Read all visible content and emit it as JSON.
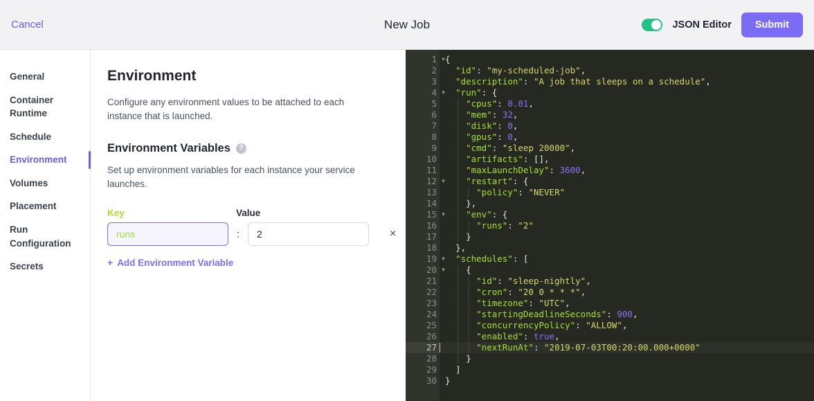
{
  "header": {
    "cancel_label": "Cancel",
    "title": "New Job",
    "toggle_label": "JSON Editor",
    "toggle_state": "on",
    "submit_label": "Submit",
    "accent_color": "#7c6cf5",
    "toggle_on_color": "#22c185",
    "background": "#f2f2f4"
  },
  "sidebar": {
    "items": [
      {
        "label": "General",
        "active": false
      },
      {
        "label": "Container Runtime",
        "active": false
      },
      {
        "label": "Schedule",
        "active": false
      },
      {
        "label": "Environment",
        "active": true
      },
      {
        "label": "Volumes",
        "active": false
      },
      {
        "label": "Placement",
        "active": false
      },
      {
        "label": "Run Configuration",
        "active": false
      },
      {
        "label": "Secrets",
        "active": false
      }
    ],
    "active_color": "#6c5ce7"
  },
  "main": {
    "title": "Environment",
    "description": "Configure any environment values to be attached to each instance that is launched.",
    "subsection": {
      "title": "Environment Variables",
      "help_icon": "question-circle-icon",
      "description": "Set up environment variables for each instance your service launches."
    },
    "labels": {
      "key": "Key",
      "value": "Value"
    },
    "separator": ":",
    "rows": [
      {
        "key": "runs",
        "value": "2",
        "key_placeholder": "",
        "value_placeholder": "",
        "key_focused": true,
        "remove_label": "×"
      }
    ],
    "add_label": "Add Environment Variable",
    "add_icon": "plus-icon"
  },
  "editor": {
    "active_line": 27,
    "total_lines": 30,
    "background": "#262822",
    "gutter_background": "#31342c",
    "lines": [
      {
        "n": 1,
        "fold": true,
        "indent": 0,
        "tokens": [
          {
            "t": "punct",
            "v": "{"
          }
        ]
      },
      {
        "n": 2,
        "fold": false,
        "indent": 1,
        "tokens": [
          {
            "t": "key",
            "v": "\"id\""
          },
          {
            "t": "punct",
            "v": ": "
          },
          {
            "t": "str",
            "v": "\"my-scheduled-job\""
          },
          {
            "t": "punct",
            "v": ","
          }
        ]
      },
      {
        "n": 3,
        "fold": false,
        "indent": 1,
        "tokens": [
          {
            "t": "key",
            "v": "\"description\""
          },
          {
            "t": "punct",
            "v": ": "
          },
          {
            "t": "str",
            "v": "\"A job that sleeps on a schedule\""
          },
          {
            "t": "punct",
            "v": ","
          }
        ]
      },
      {
        "n": 4,
        "fold": true,
        "indent": 1,
        "tokens": [
          {
            "t": "key",
            "v": "\"run\""
          },
          {
            "t": "punct",
            "v": ": {"
          }
        ]
      },
      {
        "n": 5,
        "fold": false,
        "indent": 2,
        "tokens": [
          {
            "t": "key",
            "v": "\"cpus\""
          },
          {
            "t": "punct",
            "v": ": "
          },
          {
            "t": "num",
            "v": "0.01"
          },
          {
            "t": "punct",
            "v": ","
          }
        ]
      },
      {
        "n": 6,
        "fold": false,
        "indent": 2,
        "tokens": [
          {
            "t": "key",
            "v": "\"mem\""
          },
          {
            "t": "punct",
            "v": ": "
          },
          {
            "t": "num",
            "v": "32"
          },
          {
            "t": "punct",
            "v": ","
          }
        ]
      },
      {
        "n": 7,
        "fold": false,
        "indent": 2,
        "tokens": [
          {
            "t": "key",
            "v": "\"disk\""
          },
          {
            "t": "punct",
            "v": ": "
          },
          {
            "t": "num",
            "v": "0"
          },
          {
            "t": "punct",
            "v": ","
          }
        ]
      },
      {
        "n": 8,
        "fold": false,
        "indent": 2,
        "tokens": [
          {
            "t": "key",
            "v": "\"gpus\""
          },
          {
            "t": "punct",
            "v": ": "
          },
          {
            "t": "num",
            "v": "0"
          },
          {
            "t": "punct",
            "v": ","
          }
        ]
      },
      {
        "n": 9,
        "fold": false,
        "indent": 2,
        "tokens": [
          {
            "t": "key",
            "v": "\"cmd\""
          },
          {
            "t": "punct",
            "v": ": "
          },
          {
            "t": "str",
            "v": "\"sleep 20000\""
          },
          {
            "t": "punct",
            "v": ","
          }
        ]
      },
      {
        "n": 10,
        "fold": false,
        "indent": 2,
        "tokens": [
          {
            "t": "key",
            "v": "\"artifacts\""
          },
          {
            "t": "punct",
            "v": ": [],"
          }
        ]
      },
      {
        "n": 11,
        "fold": false,
        "indent": 2,
        "tokens": [
          {
            "t": "key",
            "v": "\"maxLaunchDelay\""
          },
          {
            "t": "punct",
            "v": ": "
          },
          {
            "t": "num",
            "v": "3600"
          },
          {
            "t": "punct",
            "v": ","
          }
        ]
      },
      {
        "n": 12,
        "fold": true,
        "indent": 2,
        "tokens": [
          {
            "t": "key",
            "v": "\"restart\""
          },
          {
            "t": "punct",
            "v": ": {"
          }
        ]
      },
      {
        "n": 13,
        "fold": false,
        "indent": 3,
        "tokens": [
          {
            "t": "key",
            "v": "\"policy\""
          },
          {
            "t": "punct",
            "v": ": "
          },
          {
            "t": "str",
            "v": "\"NEVER\""
          }
        ]
      },
      {
        "n": 14,
        "fold": false,
        "indent": 2,
        "tokens": [
          {
            "t": "punct",
            "v": "},"
          }
        ]
      },
      {
        "n": 15,
        "fold": true,
        "indent": 2,
        "tokens": [
          {
            "t": "key",
            "v": "\"env\""
          },
          {
            "t": "punct",
            "v": ": {"
          }
        ]
      },
      {
        "n": 16,
        "fold": false,
        "indent": 3,
        "tokens": [
          {
            "t": "key",
            "v": "\"runs\""
          },
          {
            "t": "punct",
            "v": ": "
          },
          {
            "t": "str",
            "v": "\"2\""
          }
        ]
      },
      {
        "n": 17,
        "fold": false,
        "indent": 2,
        "tokens": [
          {
            "t": "punct",
            "v": "}"
          }
        ]
      },
      {
        "n": 18,
        "fold": false,
        "indent": 1,
        "tokens": [
          {
            "t": "punct",
            "v": "},"
          }
        ]
      },
      {
        "n": 19,
        "fold": true,
        "indent": 1,
        "tokens": [
          {
            "t": "key",
            "v": "\"schedules\""
          },
          {
            "t": "punct",
            "v": ": ["
          }
        ]
      },
      {
        "n": 20,
        "fold": true,
        "indent": 2,
        "tokens": [
          {
            "t": "punct",
            "v": "{"
          }
        ]
      },
      {
        "n": 21,
        "fold": false,
        "indent": 3,
        "tokens": [
          {
            "t": "key",
            "v": "\"id\""
          },
          {
            "t": "punct",
            "v": ": "
          },
          {
            "t": "str",
            "v": "\"sleep-nightly\""
          },
          {
            "t": "punct",
            "v": ","
          }
        ]
      },
      {
        "n": 22,
        "fold": false,
        "indent": 3,
        "tokens": [
          {
            "t": "key",
            "v": "\"cron\""
          },
          {
            "t": "punct",
            "v": ": "
          },
          {
            "t": "str",
            "v": "\"20 0 * * *\""
          },
          {
            "t": "punct",
            "v": ","
          }
        ]
      },
      {
        "n": 23,
        "fold": false,
        "indent": 3,
        "tokens": [
          {
            "t": "key",
            "v": "\"timezone\""
          },
          {
            "t": "punct",
            "v": ": "
          },
          {
            "t": "str",
            "v": "\"UTC\""
          },
          {
            "t": "punct",
            "v": ","
          }
        ]
      },
      {
        "n": 24,
        "fold": false,
        "indent": 3,
        "tokens": [
          {
            "t": "key",
            "v": "\"startingDeadlineSeconds\""
          },
          {
            "t": "punct",
            "v": ": "
          },
          {
            "t": "num",
            "v": "900"
          },
          {
            "t": "punct",
            "v": ","
          }
        ]
      },
      {
        "n": 25,
        "fold": false,
        "indent": 3,
        "tokens": [
          {
            "t": "key",
            "v": "\"concurrencyPolicy\""
          },
          {
            "t": "punct",
            "v": ": "
          },
          {
            "t": "str",
            "v": "\"ALLOW\""
          },
          {
            "t": "punct",
            "v": ","
          }
        ]
      },
      {
        "n": 26,
        "fold": false,
        "indent": 3,
        "tokens": [
          {
            "t": "key",
            "v": "\"enabled\""
          },
          {
            "t": "punct",
            "v": ": "
          },
          {
            "t": "bool",
            "v": "true"
          },
          {
            "t": "punct",
            "v": ","
          }
        ]
      },
      {
        "n": 27,
        "fold": false,
        "indent": 3,
        "tokens": [
          {
            "t": "key",
            "v": "\"nextRunAt\""
          },
          {
            "t": "punct",
            "v": ": "
          },
          {
            "t": "str",
            "v": "\"2019-07-03T00:20:00.000+0000\""
          }
        ]
      },
      {
        "n": 28,
        "fold": false,
        "indent": 2,
        "tokens": [
          {
            "t": "punct",
            "v": "}"
          }
        ]
      },
      {
        "n": 29,
        "fold": false,
        "indent": 1,
        "tokens": [
          {
            "t": "punct",
            "v": "]"
          }
        ]
      },
      {
        "n": 30,
        "fold": false,
        "indent": 0,
        "tokens": [
          {
            "t": "punct",
            "v": "}"
          }
        ]
      }
    ]
  }
}
